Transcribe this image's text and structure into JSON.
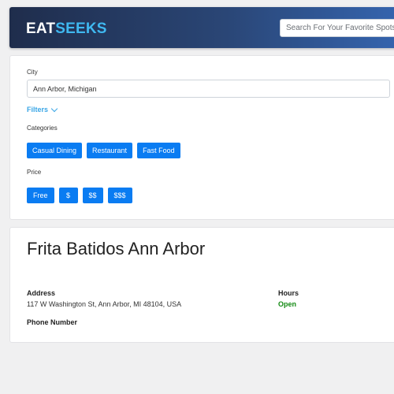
{
  "header": {
    "logo_part1": "EAT",
    "logo_part2": "SEEKS",
    "search_placeholder": "Search For Your Favorite Spots",
    "gradient_colors": [
      "#1f2d4c",
      "#3565b0"
    ],
    "logo_accent": "#3fb8f0"
  },
  "filters": {
    "city_label": "City",
    "city_value": "Ann Arbor, Michigan",
    "toggle_label": "Filters",
    "toggle_icon": "chevron-down-icon",
    "toggle_color": "#3aa6e6",
    "categories_label": "Categories",
    "categories": [
      "Casual Dining",
      "Restaurant",
      "Fast Food"
    ],
    "price_label": "Price",
    "prices": [
      "Free",
      "$",
      "$$",
      "$$$"
    ],
    "button_color": "#0a7cf2"
  },
  "restaurant": {
    "name": "Frita Batidos Ann Arbor",
    "address_label": "Address",
    "address": "117 W Washington St, Ann Arbor, MI 48104, USA",
    "hours_label": "Hours",
    "hours_status": "Open",
    "hours_status_color": "#138a13",
    "phone_label": "Phone Number"
  }
}
